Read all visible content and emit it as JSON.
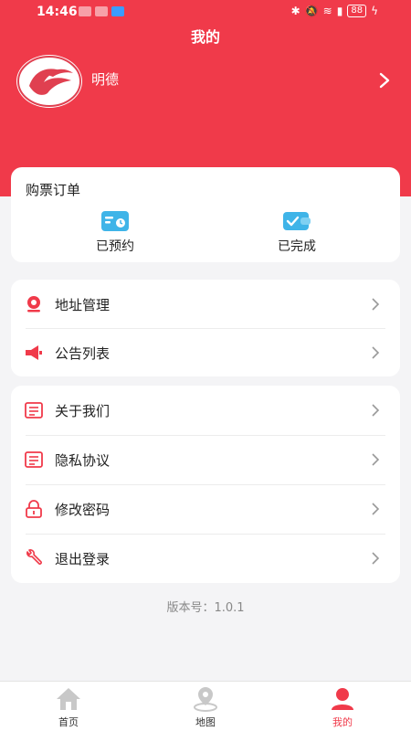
{
  "status_bar": {
    "time": "14:46",
    "battery": "88"
  },
  "header": {
    "title": "我的"
  },
  "profile": {
    "name": "明德"
  },
  "orders": {
    "title": "购票订单",
    "items": [
      {
        "label": "已预约",
        "icon": "reserved-ticket-icon"
      },
      {
        "label": "已完成",
        "icon": "completed-wallet-icon"
      }
    ]
  },
  "menu_group_1": [
    {
      "label": "地址管理",
      "icon": "location-icon"
    },
    {
      "label": "公告列表",
      "icon": "megaphone-icon"
    }
  ],
  "menu_group_2": [
    {
      "label": "关于我们",
      "icon": "info-doc-icon"
    },
    {
      "label": "隐私协议",
      "icon": "privacy-doc-icon"
    },
    {
      "label": "修改密码",
      "icon": "lock-icon"
    },
    {
      "label": "退出登录",
      "icon": "wrench-icon"
    }
  ],
  "version": "版本号：1.0.1",
  "tabbar": {
    "tabs": [
      {
        "label": "首页",
        "icon": "home-icon",
        "active": false
      },
      {
        "label": "地图",
        "icon": "map-pin-icon",
        "active": false
      },
      {
        "label": "我的",
        "icon": "user-icon",
        "active": true
      }
    ]
  },
  "colors": {
    "accent": "#f03a4a",
    "background": "#f4f4f6",
    "order_icon": "#3fb4e8"
  }
}
